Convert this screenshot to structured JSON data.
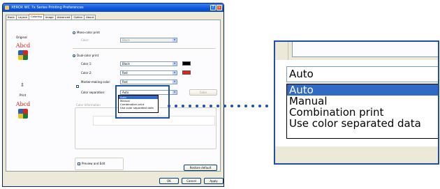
{
  "dialog": {
    "title": "XEROX WC 7x Series Printing Preferences",
    "tabs": [
      "Basic",
      "Layout",
      "Coloring",
      "Image",
      "Advanced",
      "Option",
      "About"
    ],
    "active_tab": "Coloring",
    "original_label": "Original",
    "print_label": "Print",
    "sample_text": "Abcd",
    "mono_color_print": "Mono-color print",
    "color_label": "Color:",
    "mono_color_value": "Black",
    "dual_color_print": "Dual-color print",
    "color1_label": "Color 1:",
    "color1_value": "Black",
    "color2_label": "Color 2:",
    "color2_value": "Red",
    "marker_color_label": "Marker-making color:",
    "marker_color_value": "Red",
    "color_separation_label": "Color separation:",
    "color_separation_value": "Auto",
    "color_button": "Color",
    "color_information_label": "Color Information",
    "preview_edit": "Preview and Edit",
    "restore_default": "Restore default",
    "ok": "OK",
    "cancel": "Cancel",
    "apply": "Apply",
    "colors": {
      "black": "#000000",
      "red": "#d8261c",
      "highlight": "#1f4fa8",
      "selection": "#316ac5"
    }
  },
  "zoom": {
    "current_value": "Auto",
    "options": [
      "Auto",
      "Manual",
      "Combination print",
      "Use color separated data"
    ],
    "selected_index": 0
  }
}
